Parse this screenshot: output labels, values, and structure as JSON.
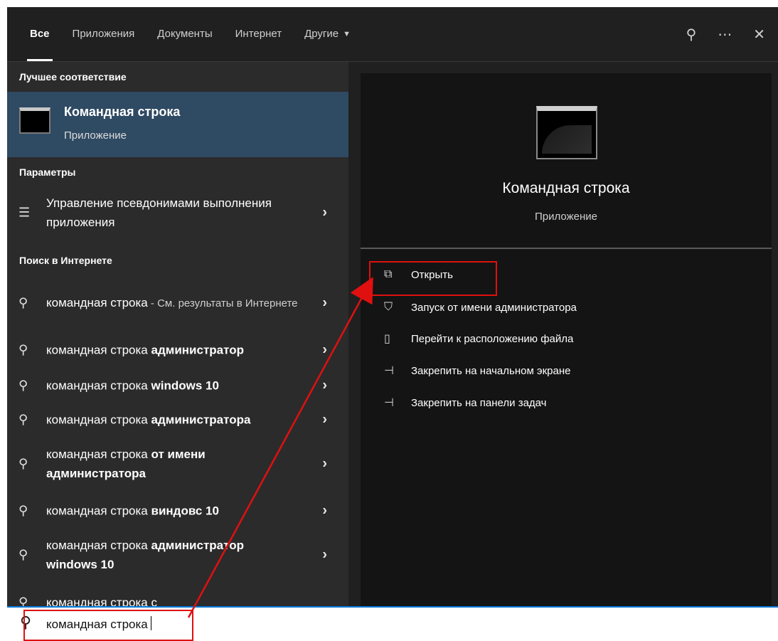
{
  "tabs": [
    "Все",
    "Приложения",
    "Документы",
    "Интернет",
    "Другие"
  ],
  "header_icons": [
    "feedback-icon",
    "more-icon",
    "close-icon"
  ],
  "sections": {
    "best_match": "Лучшее соответствие",
    "settings": "Параметры",
    "web_search": "Поиск в Интернете"
  },
  "best_match": {
    "title": "Командная строка",
    "subtitle": "Приложение"
  },
  "settings_item": {
    "text": "Управление псевдонимами выполнения приложения"
  },
  "web_items": [
    {
      "query": "командная строка",
      "suffix": "",
      "sub": " - См. результаты в Интернете"
    },
    {
      "query": "командная строка ",
      "suffix": "администратор",
      "sub": ""
    },
    {
      "query": "командная строка ",
      "suffix": "windows 10",
      "sub": ""
    },
    {
      "query": "командная строка ",
      "suffix": "администратора",
      "sub": ""
    },
    {
      "query": "командная строка ",
      "suffix": "от имени администратора",
      "sub": ""
    },
    {
      "query": "командная строка ",
      "suffix": "виндовс 10",
      "sub": ""
    },
    {
      "query": "командная строка ",
      "suffix": "администратор windows 10",
      "sub": ""
    },
    {
      "query": "командная строка с",
      "suffix": "",
      "sub": ""
    }
  ],
  "preview": {
    "title": "Командная строка",
    "subtitle": "Приложение",
    "actions": [
      {
        "label": "Открыть",
        "icon": "open-icon"
      },
      {
        "label": "Запуск от имени администратора",
        "icon": "shield-icon"
      },
      {
        "label": "Перейти к расположению файла",
        "icon": "folder-icon"
      },
      {
        "label": "Закрепить на начальном экране",
        "icon": "pin-icon"
      },
      {
        "label": "Закрепить на панели задач",
        "icon": "pin-icon"
      }
    ]
  },
  "search": {
    "value": "командная строка"
  },
  "colors": {
    "accent": "#0078d7",
    "highlight": "#2f4a63",
    "annotation": "#e01010"
  }
}
